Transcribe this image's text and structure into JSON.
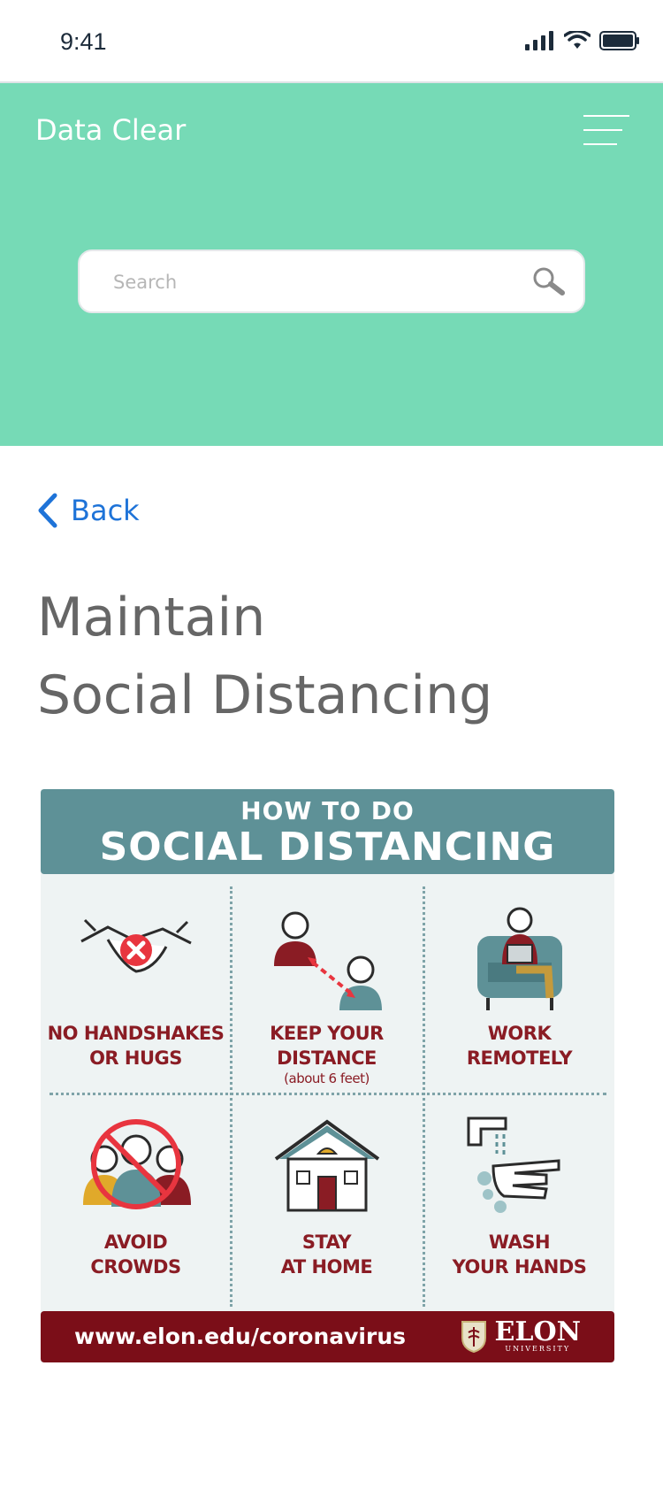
{
  "status_bar": {
    "time": "9:41"
  },
  "header": {
    "app_title": "Data Clear",
    "search": {
      "placeholder": "Search",
      "value": ""
    },
    "background_color": "#76dab6"
  },
  "content": {
    "back_label": "Back",
    "title_line1": "Maintain",
    "title_line2": "Social Distancing"
  },
  "poster": {
    "heading_small": "HOW TO DO",
    "heading_big": "SOCIAL DISTANCING",
    "tips": [
      {
        "line1": "NO HANDSHAKES",
        "line2": "OR HUGS",
        "icon": "handshake-icon"
      },
      {
        "line1": "KEEP YOUR",
        "line2": "DISTANCE",
        "note": "(about 6 feet)",
        "icon": "distance-icon"
      },
      {
        "line1": "WORK",
        "line2": "REMOTELY",
        "icon": "work-remotely-icon"
      },
      {
        "line1": "AVOID",
        "line2": "CROWDS",
        "icon": "crowd-icon"
      },
      {
        "line1": "STAY",
        "line2": "AT HOME",
        "icon": "house-icon"
      },
      {
        "line1": "WASH",
        "line2": "YOUR HANDS",
        "icon": "wash-hands-icon"
      }
    ],
    "footer_url": "www.elon.edu/coronavirus",
    "logo_text": "ELON",
    "logo_sub": "UNIVERSITY",
    "colors": {
      "teal": "#5e9197",
      "maroon": "#7b0e18",
      "red": "#e8353f"
    }
  }
}
